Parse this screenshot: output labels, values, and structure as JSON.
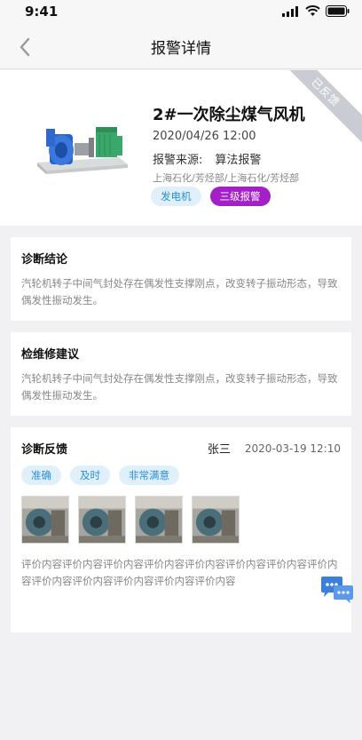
{
  "status_bar": {
    "time": "9:41",
    "icons": [
      "signal-icon",
      "wifi-icon",
      "battery-icon"
    ]
  },
  "nav": {
    "title": "报警详情",
    "back_icon": "back-arrow-icon"
  },
  "device": {
    "name": "2#一次除尘煤气风机",
    "date": "2020/04/26 12:00",
    "source_label": "报警来源:",
    "source_value": "算法报警",
    "org_path": "上海石化/芳烃部/上海石化/芳烃部",
    "type_tag": "发电机",
    "level_tag": "三级报警",
    "ribbon": "已反馈"
  },
  "diagnosis": {
    "title": "诊断结论",
    "body": "汽轮机转子中间气封处存在偶发性支撑刚点，改变转子振动形态，导致偶发性振动发生。"
  },
  "maintenance": {
    "title": "检维修建议",
    "body": "汽轮机转子中间气封处存在偶发性支撑刚点，改变转子振动形态，导致偶发性振动发生。"
  },
  "feedback": {
    "title": "诊断反馈",
    "user": "张三",
    "time": "2020-03-19 12:10",
    "chips": [
      "准确",
      "及时",
      "非常满意"
    ],
    "text": "评价内容评价内容评价内容评价内容评价内容评价内容评价内容评价内容评价内容评价内容评价内容评价内容评价内容"
  },
  "colors": {
    "accent_blue": "#2d8fd6",
    "tag_bg": "#dff0fb",
    "alarm_purple": "#a51fc9",
    "ribbon_gray": "#c9ccd3"
  }
}
